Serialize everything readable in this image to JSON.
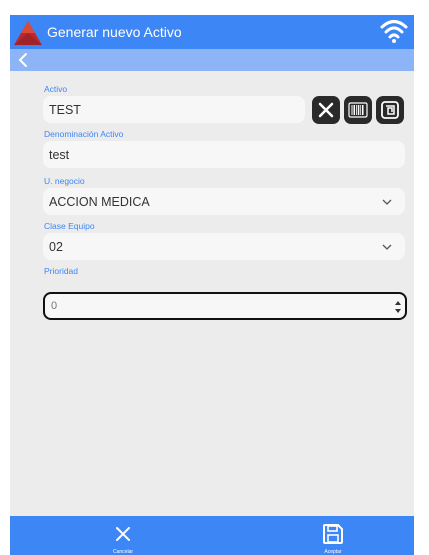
{
  "header": {
    "title": "Generar nuevo Activo"
  },
  "form": {
    "activo": {
      "label": "Activo",
      "value": "TEST"
    },
    "denominacion": {
      "label": "Denominación Activo",
      "value": "test"
    },
    "unegocio": {
      "label": "U. negocio",
      "value": "ACCION MEDICA"
    },
    "clase": {
      "label": "Clase Equipo",
      "value": "02"
    },
    "prioridad": {
      "label": "Prioridad",
      "value": "0"
    }
  },
  "footer": {
    "cancel_label": "Cancelar",
    "accept_label": "Aceptar"
  },
  "colors": {
    "primary": "#3d86f6",
    "secondary": "#8cb4f7",
    "background": "#ececec"
  },
  "icons": [
    "app-logo-icon",
    "wifi-icon",
    "back-icon",
    "clear-icon",
    "barcode-icon",
    "nfc-icon",
    "chevron-down-icon",
    "close-icon",
    "save-icon"
  ]
}
